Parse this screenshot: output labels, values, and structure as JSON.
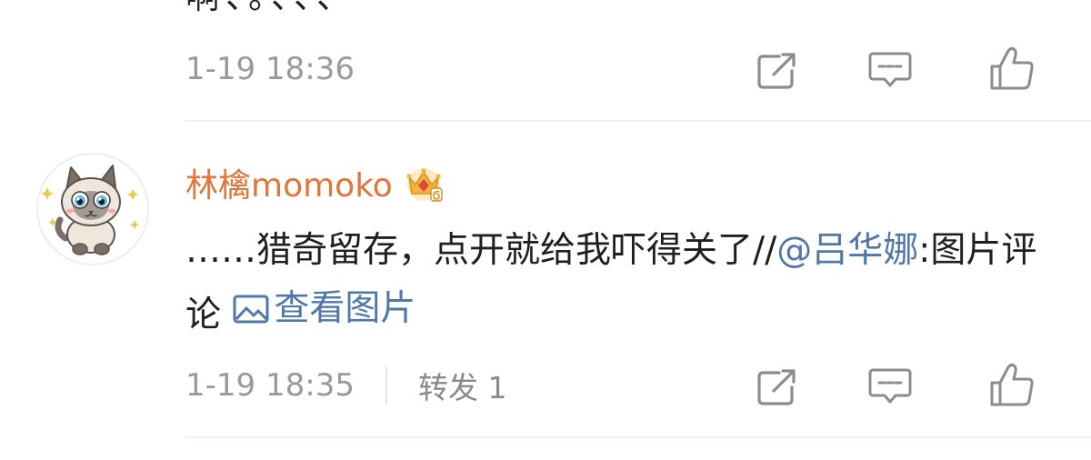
{
  "comment_above": {
    "visible_text_fragment": "啊、。、、、",
    "timestamp": "1-19 18:36",
    "actions": {
      "repost_icon": "share-square-icon",
      "reply_icon": "comment-bubble-icon",
      "like_icon": "thumbs-up-icon"
    }
  },
  "comment": {
    "username": "林檎momoko",
    "badge": "crown-vip-badge-icon",
    "text_before_mention": "……猎奇留存，点开就给我吓得关了//",
    "mention": "@吕华娜",
    "text_after_mention": ":图片评论 ",
    "view_picture_label": "查看图片",
    "timestamp": "1-19 18:35",
    "repost_label": "转发 1",
    "actions": {
      "repost_icon": "share-square-icon",
      "reply_icon": "comment-bubble-icon",
      "like_icon": "thumbs-up-icon"
    }
  },
  "colors": {
    "username": "#e3743a",
    "link": "#4e78a8",
    "meta_gray": "#9a9a9a",
    "icon_gray": "#8c8c8c",
    "divider": "#efefef"
  }
}
